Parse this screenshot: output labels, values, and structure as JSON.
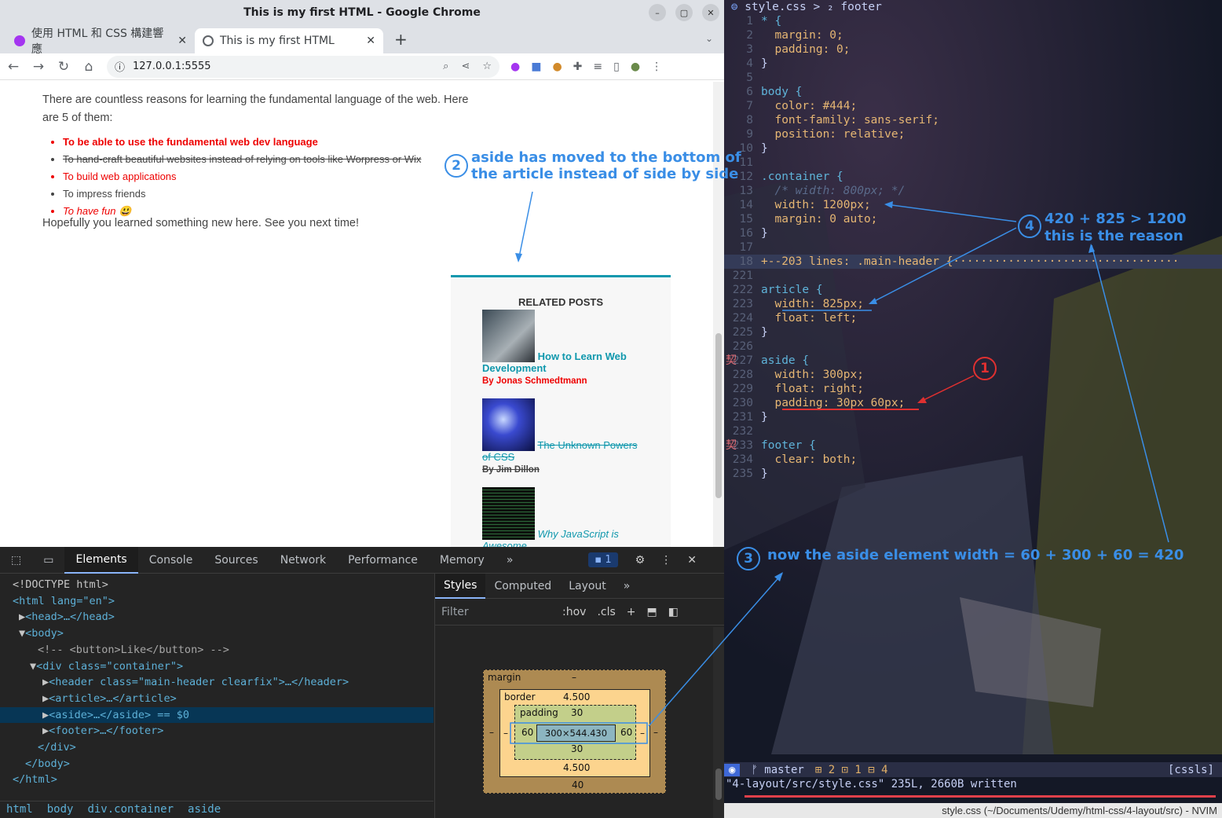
{
  "window_title": "This is my first HTML - Google Chrome",
  "window_controls": {
    "min": "–",
    "max": "▢",
    "close": "✕"
  },
  "tabs": [
    {
      "label": "使用 HTML 和 CSS 構建響應",
      "close": "✕"
    },
    {
      "label": "This is my first HTML",
      "close": "✕"
    }
  ],
  "new_tab": "+",
  "address": "127.0.0.1:5555",
  "page": {
    "intro": "There are countless reasons for learning the fundamental language of the web. Here are 5 of them:",
    "reasons": [
      "To be able to use the fundamental web dev language",
      "To hand-craft beautiful websites instead of relying on tools like Worpress or Wix",
      "To build web applications",
      "To impress friends",
      "To have fun 😃"
    ],
    "closing": "Hopefully you learned something new here. See you next time!",
    "aside_title": "RELATED POSTS",
    "posts": [
      {
        "title": "How to Learn Web Development",
        "author": "By Jonas Schmedtmann"
      },
      {
        "title": "The Unknown Powers of CSS",
        "author": "By Jim Dillon"
      },
      {
        "title": "Why JavaScript is Awesome",
        "author": ""
      }
    ]
  },
  "devtools": {
    "tabs": [
      "Elements",
      "Console",
      "Sources",
      "Network",
      "Performance",
      "Memory"
    ],
    "more": "»",
    "issues_badge": "1",
    "dom": [
      "<!DOCTYPE html>",
      "<html lang=\"en\">",
      "<head>…</head>",
      "<body>",
      "<!-- <button>Like</button> -->",
      "<div class=\"container\">",
      "<header class=\"main-header clearfix\">…</header>",
      "<article>…</article>",
      "<aside>…</aside> == $0",
      "<footer>…</footer>",
      "</div>",
      "</body>",
      "</html>"
    ],
    "breadcrumbs": [
      "html",
      "body",
      "div.container",
      "aside"
    ],
    "styles_tabs": [
      "Styles",
      "Computed",
      "Layout"
    ],
    "filter_placeholder": "Filter",
    "hov": ":hov",
    "cls": ".cls",
    "box": {
      "margin_label": "margin",
      "margin_top": "–",
      "margin_bottom": "40",
      "margin_left": "–",
      "margin_right": "–",
      "border_label": "border",
      "border_top": "4.500",
      "border_bottom": "4.500",
      "border_left": "–",
      "border_right": "–",
      "padding_label": "padding",
      "padding_top": "30",
      "padding_bottom": "30",
      "padding_left": "60",
      "padding_right": "60",
      "content": "300×544.430"
    }
  },
  "vim": {
    "breadcrumb": "style.css > ₂ footer",
    "lines": [
      {
        "n": "1",
        "t": "* {"
      },
      {
        "n": "2",
        "t": "  margin: 0;"
      },
      {
        "n": "3",
        "t": "  padding: 0;"
      },
      {
        "n": "4",
        "t": "}"
      },
      {
        "n": "5",
        "t": ""
      },
      {
        "n": "6",
        "t": "body {"
      },
      {
        "n": "7",
        "t": "  color: #444;"
      },
      {
        "n": "8",
        "t": "  font-family: sans-serif;"
      },
      {
        "n": "9",
        "t": "  position: relative;"
      },
      {
        "n": "10",
        "t": "}"
      },
      {
        "n": "11",
        "t": ""
      },
      {
        "n": "12",
        "t": ".container {"
      },
      {
        "n": "13",
        "t": "  /* width: 800px; */"
      },
      {
        "n": "14",
        "t": "  width: 1200px;"
      },
      {
        "n": "15",
        "t": "  margin: 0 auto;"
      },
      {
        "n": "16",
        "t": "}"
      },
      {
        "n": "17",
        "t": ""
      },
      {
        "n": "18",
        "t": "+--203 lines: .main-header {·································"
      },
      {
        "n": "221",
        "t": ""
      },
      {
        "n": "222",
        "t": "article {"
      },
      {
        "n": "223",
        "t": "  width: 825px;"
      },
      {
        "n": "224",
        "t": "  float: left;"
      },
      {
        "n": "225",
        "t": "}"
      },
      {
        "n": "226",
        "t": ""
      },
      {
        "n": "227",
        "t": "aside {"
      },
      {
        "n": "228",
        "t": "  width: 300px;"
      },
      {
        "n": "229",
        "t": "  float: right;"
      },
      {
        "n": "230",
        "t": "  padding: 30px 60px;"
      },
      {
        "n": "231",
        "t": "}"
      },
      {
        "n": "232",
        "t": ""
      },
      {
        "n": "233",
        "t": "footer {"
      },
      {
        "n": "234",
        "t": "  clear: both;"
      },
      {
        "n": "235",
        "t": "}"
      }
    ],
    "sign_glyph": "契",
    "status_mode": "◉",
    "status_branch": "ᚠ master",
    "status_diag": "⊞ 2 ⊡ 1 ⊟ 4",
    "status_right": "[cssls]",
    "cmdline": "\"4-layout/src/style.css\" 235L, 2660B written",
    "title": "style.css (~/Documents/Udemy/html-css/4-layout/src) - NVIM"
  },
  "annotations": {
    "n1": "1",
    "n2": "2",
    "t2": "aside has moved to the bottom of the article instead of side by side",
    "n3": "3",
    "t3": "now the aside element width = 60 + 300 + 60 = 420",
    "n4": "4",
    "t4a": "420 + 825 > 1200",
    "t4b": "this is the reason"
  }
}
